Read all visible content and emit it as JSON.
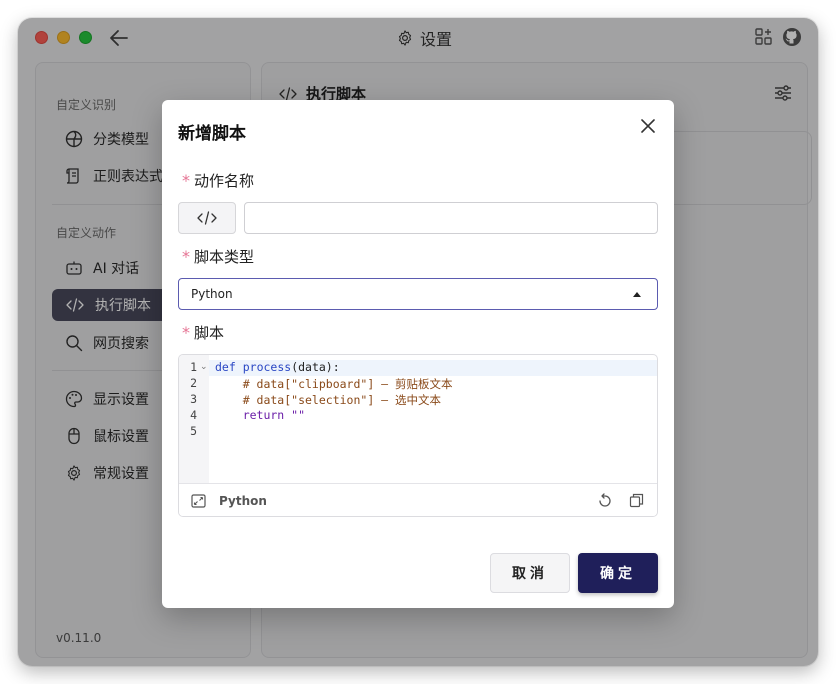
{
  "window": {
    "title": "设置"
  },
  "sidebar": {
    "sections": [
      {
        "label": "自定义识别",
        "items": [
          {
            "label": "分类模型",
            "icon": "circle-grid-icon"
          },
          {
            "label": "正则表达式",
            "icon": "scroll-icon"
          }
        ]
      },
      {
        "label": "自定义动作",
        "items": [
          {
            "label": "AI 对话",
            "icon": "robot-icon"
          },
          {
            "label": "执行脚本",
            "icon": "code-icon",
            "active": true
          },
          {
            "label": "网页搜索",
            "icon": "search-icon"
          }
        ]
      },
      {
        "label": "",
        "items": [
          {
            "label": "显示设置",
            "icon": "palette-icon"
          },
          {
            "label": "鼠标设置",
            "icon": "mouse-icon"
          },
          {
            "label": "常规设置",
            "icon": "gear-icon"
          }
        ]
      }
    ],
    "version": "v0.11.0"
  },
  "main": {
    "title": "执行脚本"
  },
  "dialog": {
    "title": "新增脚本",
    "required_mark": "*",
    "name_label": "动作名称",
    "name_value": "",
    "type_label": "脚本类型",
    "type_value": "Python",
    "script_label": "脚本",
    "code_lines": [
      {
        "n": "1",
        "text": "def process(data):"
      },
      {
        "n": "2",
        "text": "    # data[\"clipboard\"] — 剪贴板文本"
      },
      {
        "n": "3",
        "text": "    # data[\"selection\"] — 选中文本"
      },
      {
        "n": "4",
        "text": "    return \"\""
      },
      {
        "n": "5",
        "text": ""
      }
    ],
    "editor_language": "Python",
    "cancel_label": "取消",
    "ok_label": "确定"
  },
  "colors": {
    "accent": "#1f1f5a",
    "required": "#e57394",
    "sidebar_active": "#4a4a5c"
  }
}
